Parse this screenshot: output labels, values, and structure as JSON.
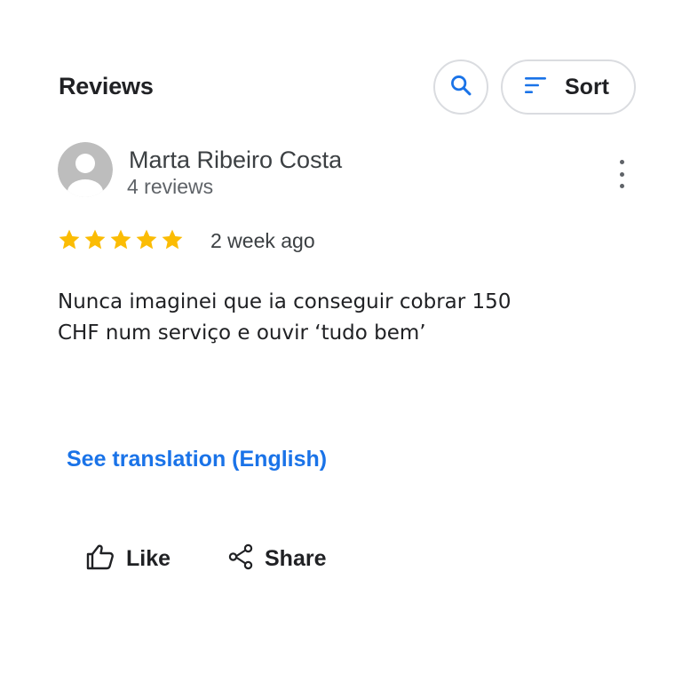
{
  "header": {
    "title": "Reviews",
    "sort_label": "Sort"
  },
  "review": {
    "author": "Marta Ribeiro Costa",
    "author_reviews": "4 reviews",
    "rating": 5,
    "max_rating": 5,
    "date": "2 week ago",
    "text_lines": [
      "Nunca imaginei que ia conseguir cobrar 150",
      "CHF num serviço e ouvir ‘tudo bem’"
    ],
    "see_translation": "See translation (English)"
  },
  "actions": {
    "like_label": "Like",
    "share_label": "Share"
  },
  "colors": {
    "accent": "#1a73e8",
    "star": "#fbbc04",
    "border": "#dadce0",
    "text_primary": "#202124",
    "text_secondary": "#5f6368"
  },
  "icons": {
    "search": "search-icon",
    "sort": "sort-icon",
    "avatar": "person-avatar-icon",
    "more": "more-vert-icon",
    "star": "star-icon",
    "like": "thumb-up-icon",
    "share": "share-icon"
  }
}
